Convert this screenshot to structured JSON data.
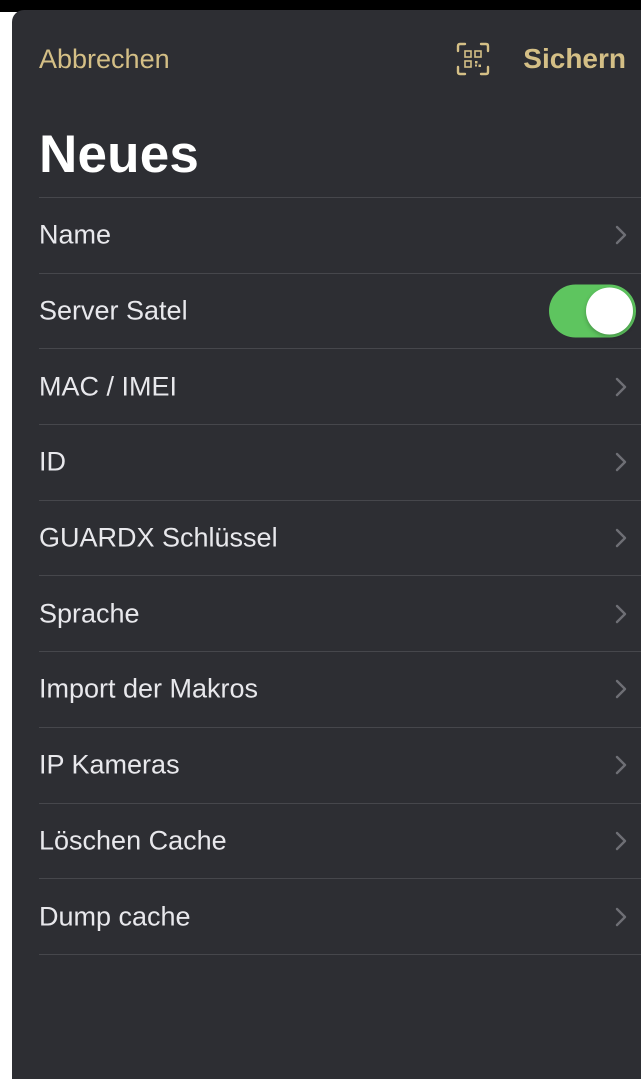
{
  "colors": {
    "sheet_background": "#2d2e33",
    "accent": "#d4bf86",
    "separator": "#46474c",
    "toggle_on": "#5ec55f",
    "text": "#e8e8ec"
  },
  "navbar": {
    "cancel_label": "Abbrechen",
    "qr_icon": "qr-code-scan-icon",
    "save_label": "Sichern"
  },
  "page": {
    "title": "Neues"
  },
  "list": {
    "items": [
      {
        "label": "Name",
        "control": "chevron"
      },
      {
        "label": "Server Satel",
        "control": "toggle",
        "toggle_on": true
      },
      {
        "label": "MAC / IMEI",
        "control": "chevron"
      },
      {
        "label": "ID",
        "control": "chevron"
      },
      {
        "label": "GUARDX Schlüssel",
        "control": "chevron"
      },
      {
        "label": "Sprache",
        "control": "chevron"
      },
      {
        "label": "Import der Makros",
        "control": "chevron"
      },
      {
        "label": "IP Kameras",
        "control": "chevron"
      },
      {
        "label": "Löschen Cache",
        "control": "chevron"
      },
      {
        "label": "Dump cache",
        "control": "chevron"
      }
    ]
  }
}
